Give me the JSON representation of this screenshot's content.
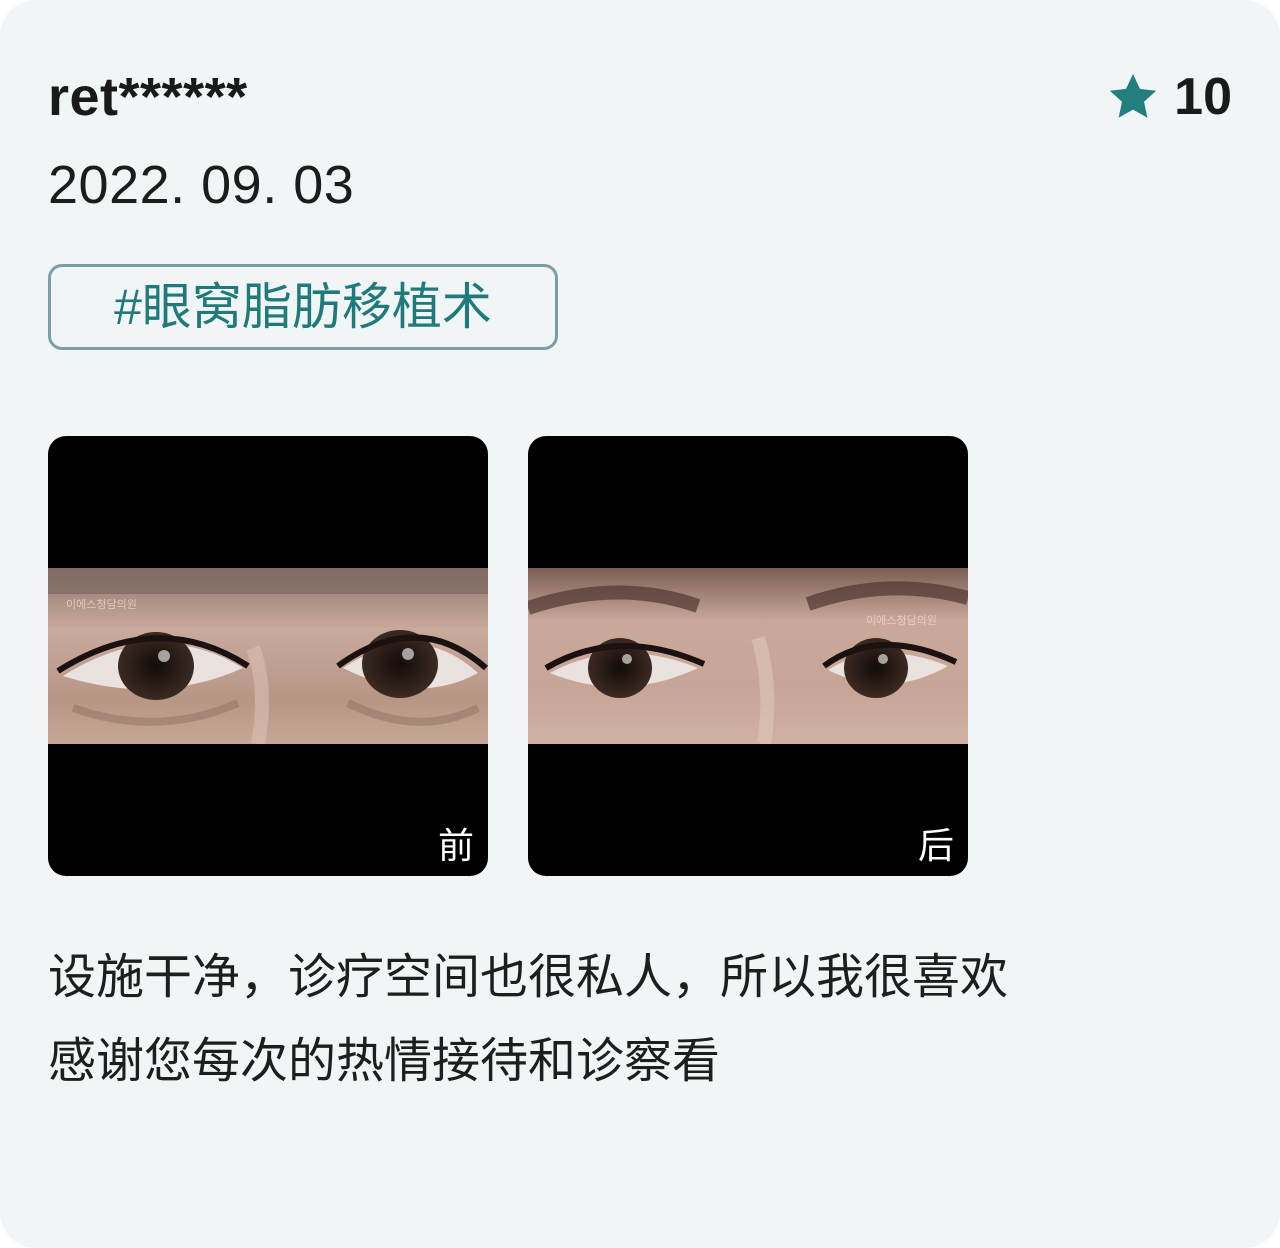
{
  "review": {
    "username": "ret******",
    "rating": "10",
    "date": "2022. 09. 03",
    "tag": "#眼窝脂肪移植术",
    "photos": [
      {
        "label": "前",
        "watermark": "이에스청담의원"
      },
      {
        "label": "后",
        "watermark": "이에스청담의원"
      }
    ],
    "text_lines": [
      "设施干净，诊疗空间也很私人，所以我很喜欢",
      "感谢您每次的热情接待和诊察看"
    ]
  },
  "colors": {
    "card_background": "#f1f5f6",
    "accent": "#1f7a7b",
    "tag_border": "#7aa0a4",
    "star": "#237f7f"
  },
  "icons": {
    "rating": "star-icon"
  }
}
